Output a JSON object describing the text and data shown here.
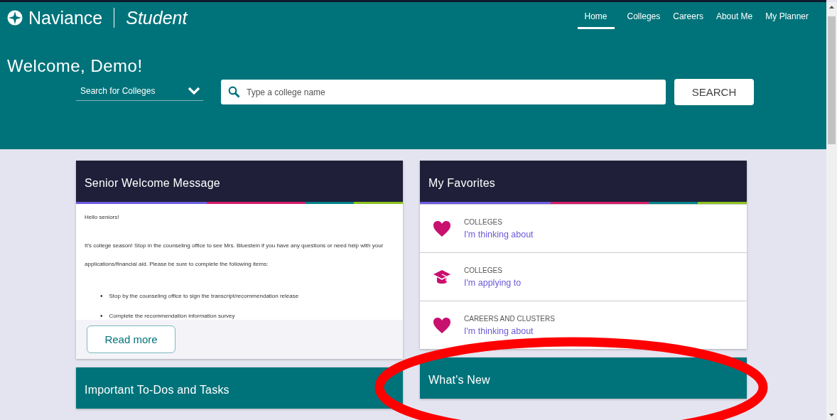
{
  "header": {
    "brand": "Naviance",
    "product": "Student",
    "nav": [
      {
        "label": "Home",
        "selected": true
      },
      {
        "label": "Colleges",
        "selected": false
      },
      {
        "label": "Careers",
        "selected": false
      },
      {
        "label": "About Me",
        "selected": false
      },
      {
        "label": "My Planner",
        "selected": false
      }
    ],
    "welcome": "Welcome, Demo!",
    "search": {
      "scope": "Search for Colleges",
      "placeholder": "Type a college name",
      "button": "SEARCH"
    }
  },
  "columns": [
    [
      {
        "kind": "message",
        "title": "Senior Welcome Message",
        "paragraphs": [
          "Hello seniors!",
          "It's college season! Stop in the counseling office to see Mrs. Bluestein if you have any questions or need help with your applications/financial aid. Please be sure to complete the following items:"
        ],
        "bullets": [
          {
            "marker": "•",
            "text": "Stop by the counseling office to sign the transcript/recommendation release"
          },
          {
            "marker": "•",
            "text": "Complete the recommendation information survey"
          }
        ],
        "button": "Read more"
      },
      {
        "kind": "collapsed",
        "title": "Important To-Dos and Tasks"
      }
    ],
    [
      {
        "kind": "favorites",
        "title": "My Favorites",
        "items": [
          {
            "category": "COLLEGES",
            "link": "I'm thinking about"
          },
          {
            "category": "COLLEGES",
            "link": "I'm applying to"
          },
          {
            "category": "CAREERS AND CLUSTERS",
            "link": "I'm thinking about"
          }
        ]
      },
      {
        "kind": "collapsed",
        "title": "What's New"
      }
    ]
  ]
}
